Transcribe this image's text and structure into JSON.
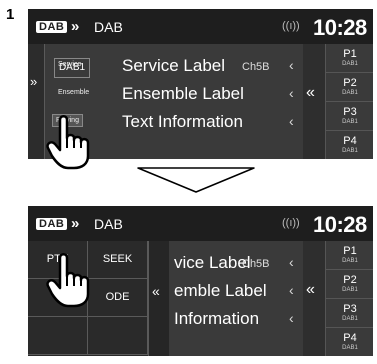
{
  "step_number": "1",
  "screen1": {
    "logo": "DAB",
    "chevron": "»",
    "source": "DAB",
    "signal": "((ı))",
    "clock": "10:28",
    "left_tab": "»",
    "channel_box": "DAB1",
    "channel": "Ch5B",
    "rows": [
      {
        "tag": "Service",
        "value": "Service Label",
        "arrow": "‹"
      },
      {
        "tag": "Ensemble",
        "value": "Ensemble Label",
        "arrow": "‹"
      },
      {
        "tag": "Playing",
        "value": "Text Information",
        "arrow": "‹"
      }
    ],
    "preset_toggle": "«",
    "presets": [
      {
        "label": "P1",
        "band": "DAB1"
      },
      {
        "label": "P2",
        "band": "DAB1"
      },
      {
        "label": "P3",
        "band": "DAB1"
      },
      {
        "label": "P4",
        "band": "DAB1"
      }
    ]
  },
  "screen2": {
    "logo": "DAB",
    "chevron": "»",
    "source": "DAB",
    "signal": "((ı))",
    "clock": "10:28",
    "channel": "Ch5B",
    "menu": {
      "pty": "PTY",
      "seek": "SEEK",
      "mode": "ODE",
      "close": "«"
    },
    "rows": [
      {
        "value": "vice Label",
        "arrow": "‹"
      },
      {
        "value": "emble Label",
        "arrow": "‹"
      },
      {
        "value": "Information",
        "arrow": "‹"
      }
    ],
    "preset_toggle": "«",
    "presets": [
      {
        "label": "P1",
        "band": "DAB1"
      },
      {
        "label": "P2",
        "band": "DAB1"
      },
      {
        "label": "P3",
        "band": "DAB1"
      },
      {
        "label": "P4",
        "band": "DAB1"
      }
    ]
  }
}
